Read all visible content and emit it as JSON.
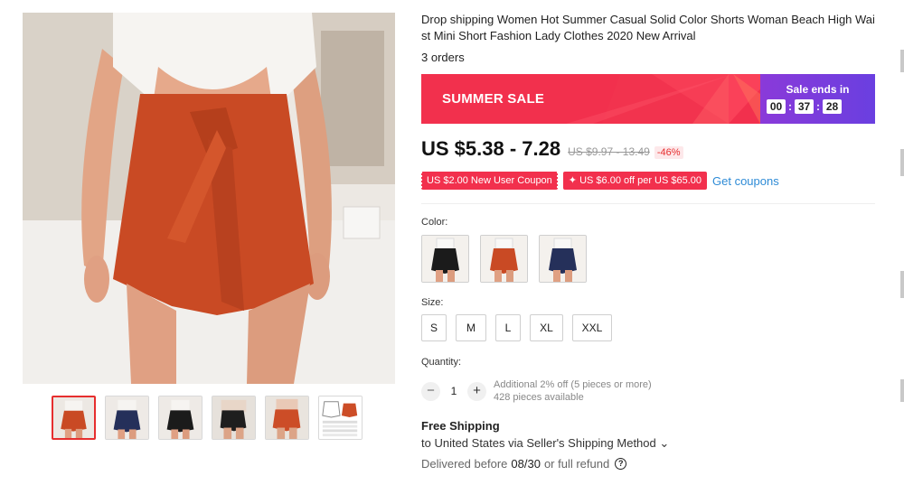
{
  "product": {
    "title": "Drop shipping Women Hot Summer Casual Solid Color Shorts Woman Beach High Waist Mini Short Fashion Lady Clothes 2020 New Arrival",
    "orders": "3 orders"
  },
  "sale": {
    "label": "SUMMER SALE",
    "ends_label": "Sale ends in",
    "timer": {
      "hours": "00",
      "minutes": "37",
      "seconds": "28"
    }
  },
  "price": {
    "current": "US $5.38 - 7.28",
    "original": "US $9.97 - 13.49",
    "discount": "-46%"
  },
  "coupons": {
    "new_user": "US $2.00 New User Coupon",
    "store": "✦ US $6.00 off per US $65.00",
    "get_coupons": "Get coupons"
  },
  "color": {
    "label": "Color:",
    "options": [
      "orange",
      "black",
      "orange",
      "navy"
    ]
  },
  "size": {
    "label": "Size:",
    "options": [
      "S",
      "M",
      "L",
      "XL",
      "XXL"
    ]
  },
  "quantity": {
    "label": "Quantity:",
    "minus": "−",
    "value": "1",
    "plus": "+",
    "discount_note": "Additional 2% off (5 pieces or more)",
    "available": "428 pieces available"
  },
  "shipping": {
    "title": "Free Shipping",
    "to": "to United States via Seller's Shipping Method ⌄",
    "delivered_prefix": "Delivered before",
    "delivered_date": "08/30",
    "delivered_suffix": "or full refund",
    "help_icon": "?"
  },
  "colors_theme": {
    "accent": "#f2304d",
    "sale_purple": "#6a3fe0",
    "link": "#2e8bd6",
    "shorts_orange": "#c94a24"
  }
}
